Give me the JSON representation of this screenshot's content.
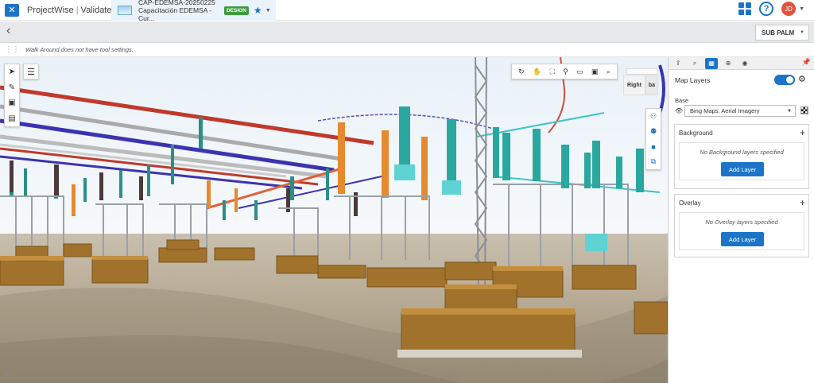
{
  "app": {
    "name": "ProjectWise",
    "module": "Validate"
  },
  "project": {
    "code": "CAP-EDEMSA-20250225",
    "name": "Capacitación EDEMSA - Cur...",
    "badge": "DESIGN"
  },
  "user": {
    "initials": "JD"
  },
  "model_selector": {
    "value": "SUB PALM"
  },
  "tool_settings": {
    "message": "Walk Around does not have tool settings."
  },
  "view_cube": {
    "front": "Right",
    "side": "ba"
  },
  "panel": {
    "header": "Map Layers",
    "base_label": "Base",
    "base_value": "Bing Maps: Aerial Imagery",
    "background": {
      "title": "Background",
      "empty": "No Background layers specified",
      "button": "Add Layer"
    },
    "overlay": {
      "title": "Overlay",
      "empty": "No Overlay layers specified",
      "button": "Add Layer"
    }
  },
  "colors": {
    "accent": "#1b74c8",
    "badge": "#3f9b3f",
    "avatar": "#e0533d"
  },
  "icons": {
    "left_tools": [
      "cursor-icon",
      "measure-icon",
      "section-icon",
      "trash-icon"
    ],
    "nav_tools": [
      "rotate-icon",
      "pan-icon",
      "fit-view-icon",
      "walk-icon",
      "window-area-icon",
      "camera-icon",
      "zoom-icon"
    ],
    "side_tools": [
      "walk-person-icon",
      "people-icon",
      "video-icon",
      "split-icon"
    ]
  }
}
